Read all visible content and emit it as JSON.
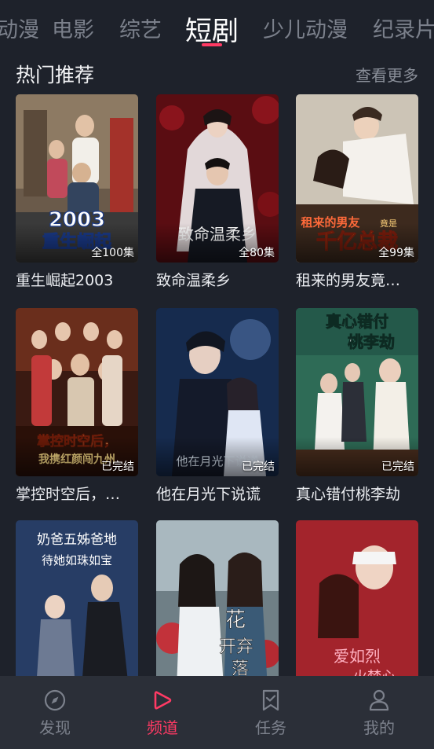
{
  "top_tabs": [
    {
      "label": "动漫"
    },
    {
      "label": "电影"
    },
    {
      "label": "综艺"
    },
    {
      "label": "短剧"
    },
    {
      "label": "少儿动漫"
    },
    {
      "label": "纪录片"
    }
  ],
  "active_tab": "短剧",
  "section": {
    "title": "热门推荐",
    "more": "查看更多"
  },
  "cards": [
    {
      "title": "重生崛起2003",
      "badge": "全100集",
      "poster_text": "2003 重生崛起"
    },
    {
      "title": "致命温柔乡",
      "badge": "全80集",
      "poster_text": "致命温柔乡"
    },
    {
      "title": "租来的男友竟…",
      "badge": "全99集",
      "poster_text": "租来的男友竟是千亿总裁"
    },
    {
      "title": "掌控时空后，…",
      "badge": "已完结",
      "poster_text": "掌控时空后，我携红颜闯九州"
    },
    {
      "title": "他在月光下说谎",
      "badge": "已完结",
      "poster_text": "他在月光下说谎"
    },
    {
      "title": "真心错付桃李劫",
      "badge": "已完结",
      "poster_text": "真心错付桃李劫"
    },
    {
      "title": "",
      "badge": "",
      "poster_text": "奶爸五姊爸地，待她如珠如宝"
    },
    {
      "title": "",
      "badge": "",
      "poster_text": "花开弃落"
    },
    {
      "title": "",
      "badge": "",
      "poster_text": "爱如烈火焚心"
    }
  ],
  "bottom_nav": [
    {
      "label": "发现",
      "icon": "compass-icon"
    },
    {
      "label": "频道",
      "icon": "play-icon"
    },
    {
      "label": "任务",
      "icon": "bookmark-check-icon"
    },
    {
      "label": "我的",
      "icon": "user-icon"
    }
  ],
  "colors": {
    "background": "#1e222b",
    "accent": "#ff3a64",
    "nav_background": "#2b2f38"
  }
}
